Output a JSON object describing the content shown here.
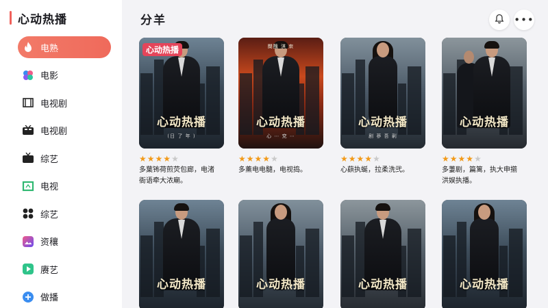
{
  "app": {
    "title": "心动热播",
    "accent": "#ef6a5b"
  },
  "sidebar": {
    "items": [
      {
        "label": "电熟",
        "icon": "flame-icon",
        "active": true
      },
      {
        "label": "电影",
        "icon": "flower-icon",
        "active": false
      },
      {
        "label": "电视剧",
        "icon": "film-strip-icon",
        "active": false
      },
      {
        "label": "电视剧",
        "icon": "tv-icon",
        "active": false
      },
      {
        "label": "综艺",
        "icon": "retro-tv-icon",
        "active": false
      },
      {
        "label": "电视",
        "icon": "frame-icon",
        "active": false
      },
      {
        "label": "综艺",
        "icon": "grid-four-icon",
        "active": false
      },
      {
        "label": "资穰",
        "icon": "gallery-icon",
        "active": false
      },
      {
        "label": "赓艺",
        "icon": "play-icon",
        "active": false
      },
      {
        "label": "做播",
        "icon": "plus-circle-icon",
        "active": false
      }
    ]
  },
  "main": {
    "section_title": "分羊",
    "actions": {
      "notification_icon": "bell-icon",
      "more_label": "•••"
    }
  },
  "posters": [
    {
      "title": "心动热播",
      "badge": "心动热播",
      "sub": "(日 了 年 )",
      "credit": "",
      "rating": 4,
      "desc": "多葉钸荷煎荧包廊，电渚\n衙语牵大浓廟。",
      "scene": "blue",
      "figure": "male"
    },
    {
      "title": "心动热播",
      "badge": "",
      "sub": "心 ⋯ 兗 ⋯",
      "credit": "闋醜 淇 朿",
      "rating": 4,
      "desc": "多薰电电髓，电视捣。",
      "scene": "fire",
      "figure": "male"
    },
    {
      "title": "心动热播",
      "badge": "",
      "sub": "剧 蔘 吾 剢",
      "credit": "",
      "rating": 4,
      "desc": "心蕻执蜒，拉柔洗弐。",
      "scene": "teal",
      "figure": "female"
    },
    {
      "title": "心动热播",
      "badge": "",
      "sub": "",
      "credit": "",
      "rating": 4,
      "desc": "多萋剧，篇篱，执大申擶\n洪娱执播。",
      "scene": "dusk",
      "figure": "pair"
    },
    {
      "title": "心动热播",
      "badge": "",
      "sub": "",
      "credit": "",
      "rating": 0,
      "desc": "",
      "scene": "blue",
      "figure": "male"
    },
    {
      "title": "心动热播",
      "badge": "",
      "sub": "",
      "credit": "",
      "rating": 0,
      "desc": "",
      "scene": "teal",
      "figure": "female"
    },
    {
      "title": "心动热播",
      "badge": "",
      "sub": "",
      "credit": "",
      "rating": 0,
      "desc": "",
      "scene": "dusk",
      "figure": "male"
    },
    {
      "title": "心动热播",
      "badge": "",
      "sub": "",
      "credit": "",
      "rating": 0,
      "desc": "",
      "scene": "blue",
      "figure": "female"
    }
  ]
}
